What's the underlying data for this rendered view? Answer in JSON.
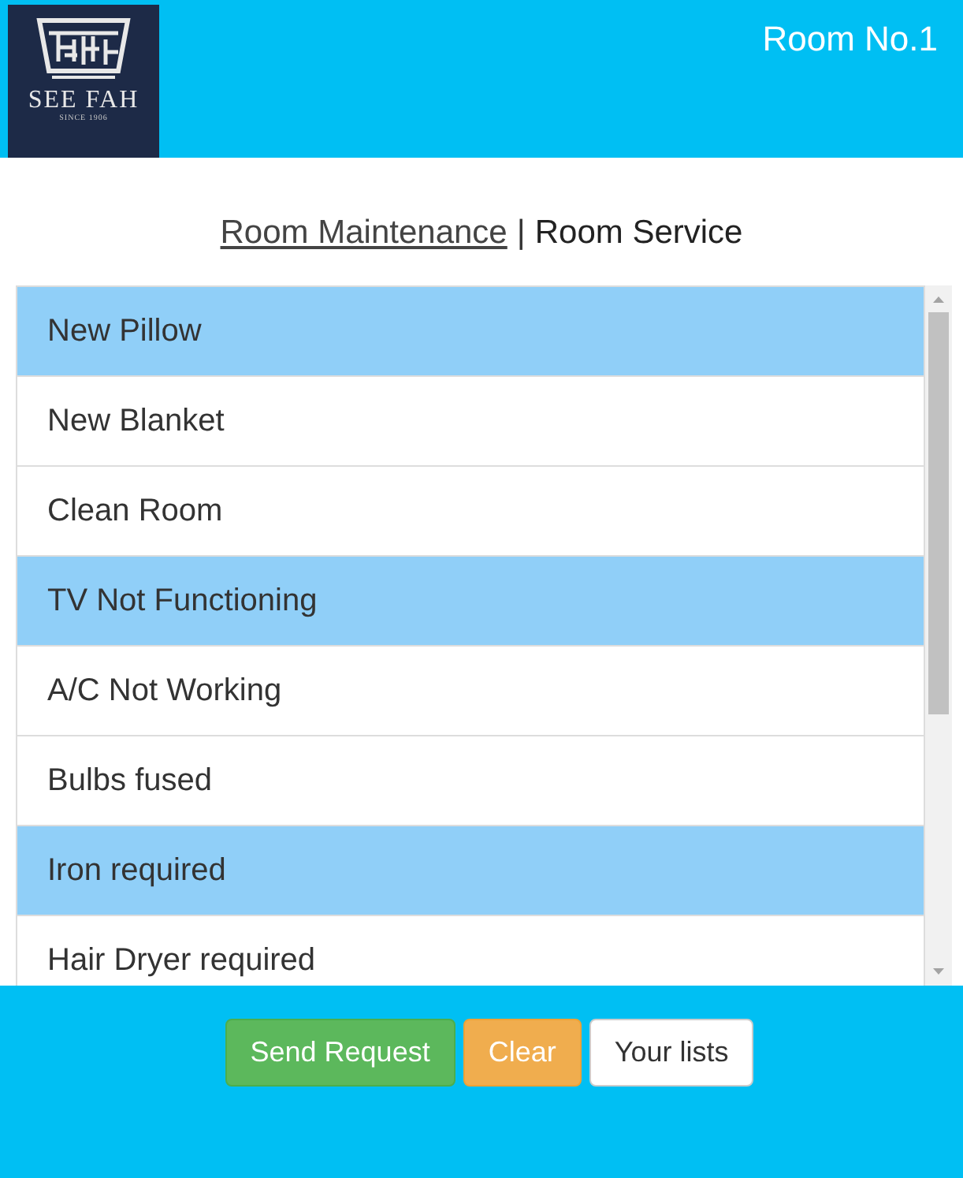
{
  "header": {
    "logo_name": "SEE FAH",
    "logo_tagline": "SINCE 1906",
    "room": "Room No.1"
  },
  "tabs": [
    {
      "label": "Room Maintenance",
      "selected": false
    },
    {
      "label": "Room Service",
      "selected": true
    }
  ],
  "tab_separator": "|",
  "items": [
    {
      "label": "New Pillow",
      "selected": true
    },
    {
      "label": "New Blanket",
      "selected": false
    },
    {
      "label": "Clean Room",
      "selected": false
    },
    {
      "label": "TV Not Functioning",
      "selected": true
    },
    {
      "label": "A/C Not Working",
      "selected": false
    },
    {
      "label": "Bulbs fused",
      "selected": false
    },
    {
      "label": "Iron required",
      "selected": true
    },
    {
      "label": "Hair Dryer required",
      "selected": false
    }
  ],
  "buttons": [
    {
      "label": "Send Request",
      "kind": "success"
    },
    {
      "label": "Clear",
      "kind": "warning"
    },
    {
      "label": "Your lists",
      "kind": "default"
    }
  ]
}
